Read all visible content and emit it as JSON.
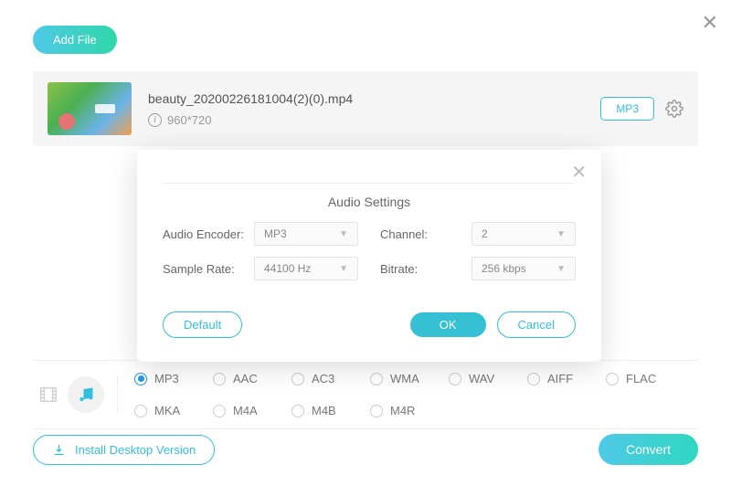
{
  "close_icon": "✕",
  "add_file_label": "Add File",
  "file": {
    "name": "beauty_20200226181004(2)(0).mp4",
    "dimensions": "960*720",
    "format_badge": "MP3"
  },
  "modal": {
    "title": "Audio Settings",
    "encoder_label": "Audio Encoder:",
    "encoder_value": "MP3",
    "channel_label": "Channel:",
    "channel_value": "2",
    "sample_rate_label": "Sample Rate:",
    "sample_rate_value": "44100 Hz",
    "bitrate_label": "Bitrate:",
    "bitrate_value": "256 kbps",
    "default_label": "Default",
    "ok_label": "OK",
    "cancel_label": "Cancel"
  },
  "formats": {
    "row1": [
      "MP3",
      "AAC",
      "AC3",
      "WMA",
      "WAV",
      "AIFF",
      "FLAC"
    ],
    "row2": [
      "MKA",
      "M4A",
      "M4B",
      "M4R"
    ],
    "selected": "MP3"
  },
  "install_label": "Install Desktop Version",
  "convert_label": "Convert"
}
